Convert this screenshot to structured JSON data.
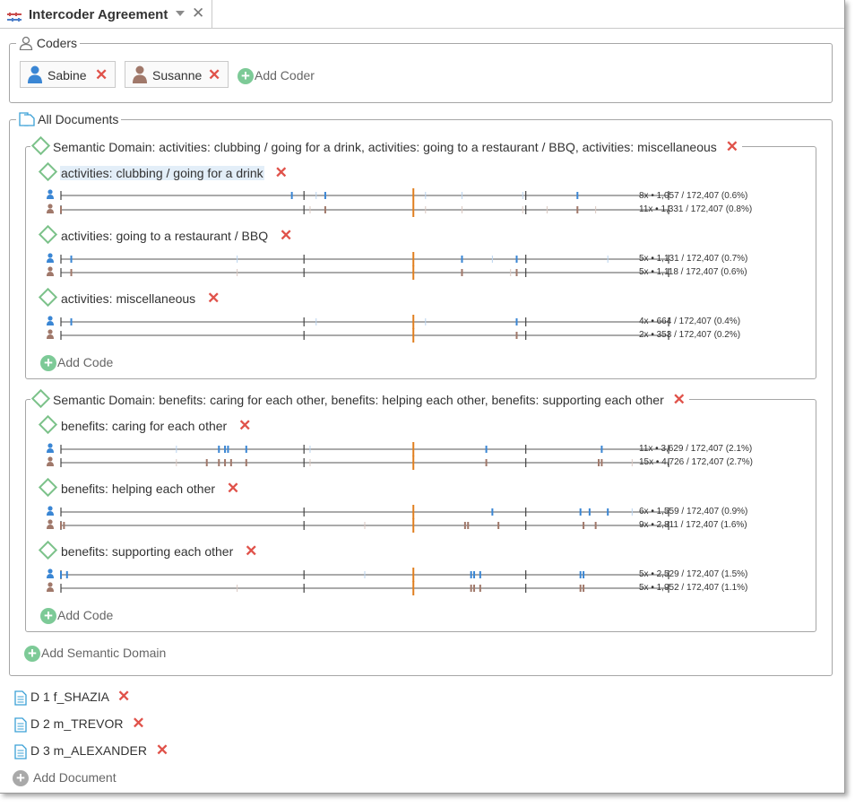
{
  "tab": {
    "title": "Intercoder Agreement",
    "close": "✕"
  },
  "coders": {
    "legend": "Coders",
    "items": [
      {
        "name": "Sabine",
        "color": "#3a86d4"
      },
      {
        "name": "Susanne",
        "color": "#a0786a"
      }
    ],
    "add_label": "Add Coder"
  },
  "documents_group": {
    "legend": "All Documents",
    "add_domain_label": "Add Semantic Domain",
    "domains": [
      {
        "title": "Semantic Domain: activities: clubbing / going for a drink, activities: going to a restaurant / BBQ, activities: miscellaneous",
        "add_code_label": "Add Code",
        "codes": [
          {
            "title": "activities: clubbing / going for a drink",
            "highlighted": true,
            "stat_a": "8x • 1,057 / 172,407 (0.6%)",
            "stat_b": "11x • 1,331 / 172,407 (0.8%)",
            "marks_a": [
              0.38,
              0.435,
              0.85
            ],
            "marks_b": [
              0.0,
              0.435,
              0.85
            ],
            "faint_a": [
              0.42,
              0.6,
              0.66,
              0.76
            ],
            "faint_b": [
              0.41,
              0.6,
              0.66,
              0.76,
              0.8,
              0.88
            ]
          },
          {
            "title": "activities: going to a restaurant / BBQ",
            "highlighted": false,
            "stat_a": "5x • 1,131 / 172,407 (0.7%)",
            "stat_b": "5x • 1,118 / 172,407 (0.6%)",
            "marks_a": [
              0.017,
              0.66,
              0.75
            ],
            "marks_b": [
              0.017,
              0.66,
              0.75
            ],
            "faint_a": [
              0.29,
              0.71,
              0.9
            ],
            "faint_b": [
              0.29,
              0.74
            ]
          },
          {
            "title": "activities: miscellaneous",
            "highlighted": false,
            "stat_a": "4x • 664 / 172,407 (0.4%)",
            "stat_b": "2x • 353 / 172,407 (0.2%)",
            "marks_a": [
              0.017,
              0.75
            ],
            "marks_b": [
              0.75
            ],
            "faint_a": [
              0.42,
              0.6
            ],
            "faint_b": []
          }
        ]
      },
      {
        "title": "Semantic Domain: benefits: caring for each other, benefits: helping each other, benefits: supporting each other",
        "add_code_label": "Add Code",
        "codes": [
          {
            "title": "benefits: caring for each other",
            "highlighted": false,
            "stat_a": "11x • 3,629 / 172,407 (2.1%)",
            "stat_b": "15x • 4,726 / 172,407 (2.7%)",
            "marks_a": [
              0.26,
              0.27,
              0.275,
              0.305,
              0.7,
              0.89
            ],
            "marks_b": [
              0.24,
              0.26,
              0.27,
              0.28,
              0.305,
              0.7,
              0.885,
              0.89
            ],
            "faint_a": [
              0.19,
              0.41
            ],
            "faint_b": [
              0.19,
              0.41,
              0.94
            ]
          },
          {
            "title": "benefits: helping each other",
            "highlighted": false,
            "stat_a": "6x • 1,559 / 172,407 (0.9%)",
            "stat_b": "9x • 2,811 / 172,407 (1.6%)",
            "marks_a": [
              0.71,
              0.855,
              0.87,
              0.9
            ],
            "marks_b": [
              0.0,
              0.005,
              0.665,
              0.67,
              0.72,
              0.86,
              0.88
            ],
            "faint_a": [
              0.94
            ],
            "faint_b": [
              0.5,
              0.72
            ]
          },
          {
            "title": "benefits: supporting each other",
            "highlighted": false,
            "stat_a": "5x • 2,529 / 172,407 (1.5%)",
            "stat_b": "5x • 1,952 / 172,407 (1.1%)",
            "marks_a": [
              0.0,
              0.01,
              0.675,
              0.68,
              0.69,
              0.855,
              0.86
            ],
            "marks_b": [
              0.675,
              0.68,
              0.69,
              0.855,
              0.86
            ],
            "faint_a": [
              0.5
            ],
            "faint_b": [
              0.29
            ]
          }
        ]
      }
    ]
  },
  "documents": [
    {
      "name": "D 1 f_SHAZIA"
    },
    {
      "name": "D 2 m_TREVOR"
    },
    {
      "name": "D 3 m_ALEXANDER"
    }
  ],
  "add_document_label": "Add Document",
  "colors": {
    "coder_a": "#3a86d4",
    "coder_b": "#a0786a",
    "midline": "#e07f1f",
    "remove": "#e0524a",
    "add": "#7dca97"
  }
}
